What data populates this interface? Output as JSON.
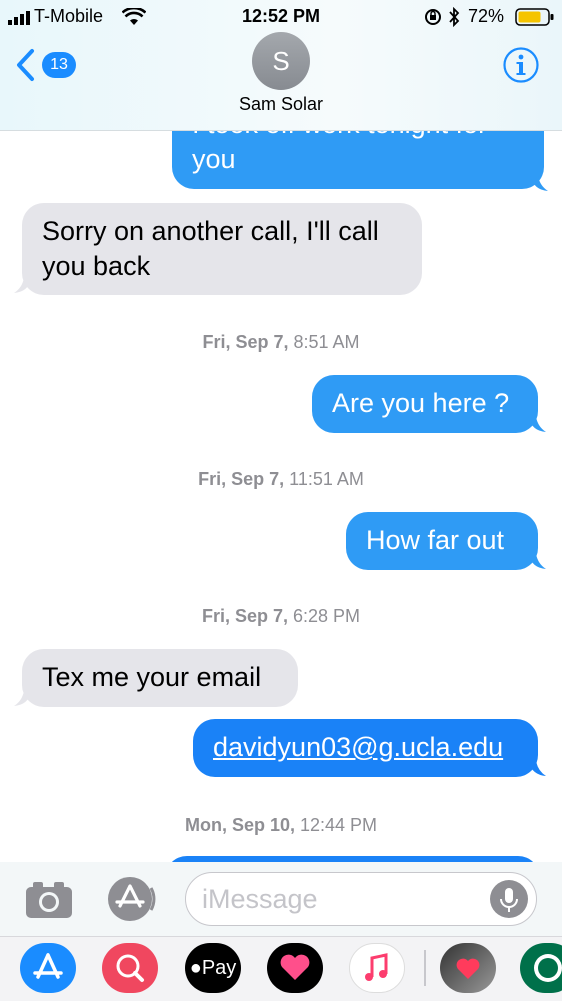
{
  "status_bar": {
    "carrier": "T-Mobile",
    "time": "12:52 PM",
    "battery": "72%"
  },
  "header": {
    "back_count": "13",
    "avatar_initial": "S",
    "contact_name": "Sam Solar"
  },
  "messages": [
    {
      "dir": "out",
      "lines": [
        "I took off work tonight for",
        "you"
      ]
    },
    {
      "dir": "in",
      "lines": [
        "Sorry on another call, I'll call",
        "you back"
      ]
    },
    {
      "dir": "out",
      "text": "Are you here ?"
    },
    {
      "dir": "out",
      "text": "How far out"
    },
    {
      "dir": "in",
      "text": "Tex me your email"
    },
    {
      "dir": "out",
      "text": "davidyun03@g.ucla.edu"
    }
  ],
  "timestamps": [
    {
      "day": "Fri, Sep 7,",
      "time": "8:51 AM"
    },
    {
      "day": "Fri, Sep 7,",
      "time": "11:51 AM"
    },
    {
      "day": "Fri, Sep 7,",
      "time": "6:28 PM"
    },
    {
      "day": "Mon, Sep 10,",
      "time": "12:44 PM"
    }
  ],
  "composer": {
    "placeholder": "iMessage"
  },
  "app_drawer": {
    "apple_pay_label": "Pay",
    "icons": [
      "app-store-icon",
      "search-images-icon",
      "apple-pay-icon",
      "digital-touch-icon",
      "music-icon",
      "memoji-icon",
      "starbucks-icon"
    ]
  },
  "colors": {
    "outgoing": "#2f9bf5",
    "incoming": "#e5e5ea",
    "accent": "#1a8cff"
  }
}
